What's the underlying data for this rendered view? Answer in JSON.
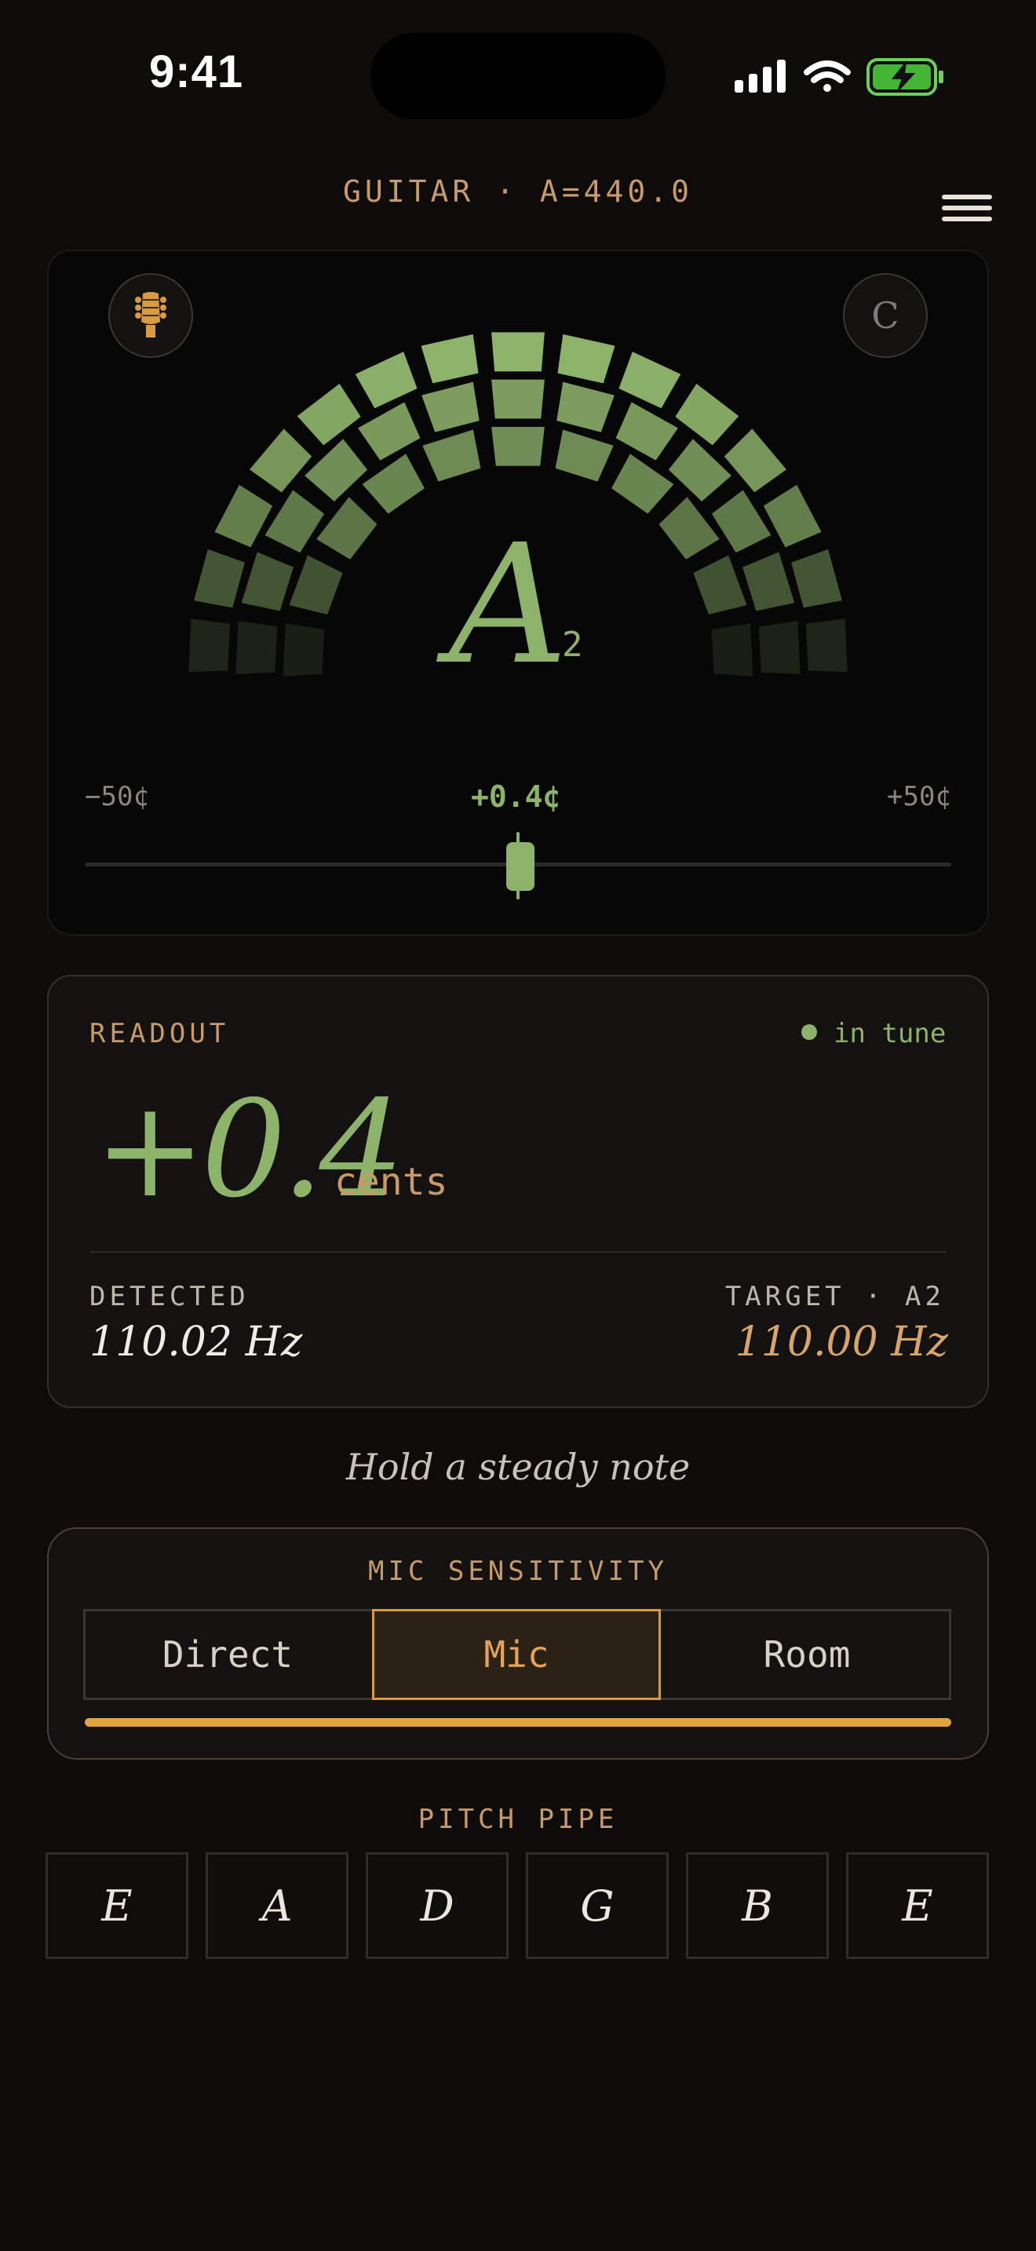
{
  "status_bar": {
    "time": "9:41"
  },
  "header": {
    "instrument": "GUITAR · A=440.0"
  },
  "tuner": {
    "note": "A",
    "octave": "2",
    "scale_min": "−50¢",
    "scale_max": "+50¢",
    "cents_display": "+0.4¢",
    "needle_cents": 0.4,
    "mode_button": "C",
    "in_tune_color": "#8db36a"
  },
  "readout": {
    "label": "READOUT",
    "status": "in tune",
    "cents_value": "+0.4",
    "cents_unit": "cents",
    "detected_label": "DETECTED",
    "detected_hz": "110.02 Hz",
    "target_label": "TARGET · A2",
    "target_hz": "110.00 Hz"
  },
  "hint": "Hold a steady note",
  "sensitivity": {
    "label": "MIC SENSITIVITY",
    "options": [
      "Direct",
      "Mic",
      "Room"
    ],
    "selected": "Mic",
    "accent": "#e0a340"
  },
  "pitch_pipe": {
    "label": "PITCH PIPE",
    "notes": [
      "E",
      "A",
      "D",
      "G",
      "B",
      "E"
    ]
  }
}
